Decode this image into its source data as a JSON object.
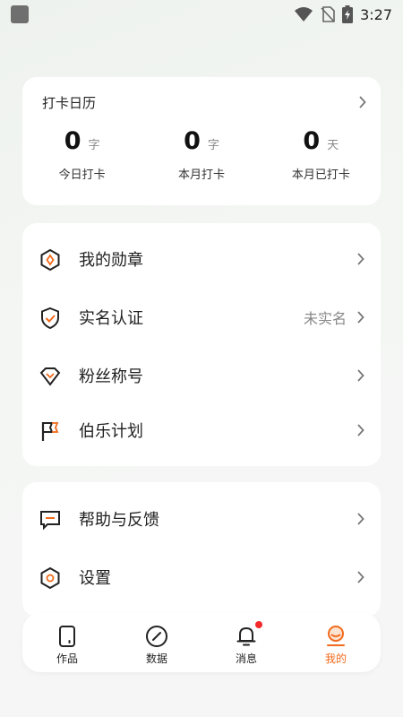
{
  "status_bar": {
    "time": "3:27"
  },
  "checkin": {
    "title": "打卡日历",
    "stats": [
      {
        "value": "0",
        "unit": "字",
        "label": "今日打卡"
      },
      {
        "value": "0",
        "unit": "字",
        "label": "本月打卡"
      },
      {
        "value": "0",
        "unit": "天",
        "label": "本月已打卡"
      }
    ]
  },
  "menu_group_1": [
    {
      "label": "我的勋章",
      "icon": "medal-icon"
    },
    {
      "label": "实名认证",
      "value": "未实名",
      "icon": "shield-check-icon"
    },
    {
      "label": "粉丝称号",
      "icon": "diamond-icon"
    },
    {
      "label": "伯乐计划",
      "icon": "flag-icon"
    }
  ],
  "menu_group_2": [
    {
      "label": "帮助与反馈",
      "icon": "message-icon"
    },
    {
      "label": "设置",
      "icon": "settings-hexagon-icon"
    }
  ],
  "bottom_nav": [
    {
      "label": "作品",
      "icon": "works-icon",
      "active": false
    },
    {
      "label": "数据",
      "icon": "data-compass-icon",
      "active": false
    },
    {
      "label": "消息",
      "icon": "bell-icon",
      "active": false,
      "badge": true
    },
    {
      "label": "我的",
      "icon": "profile-icon",
      "active": true
    }
  ],
  "colors": {
    "accent": "#f26a1b",
    "badge": "#f22a2a",
    "background": "#f4f6f4",
    "card": "#ffffff"
  }
}
